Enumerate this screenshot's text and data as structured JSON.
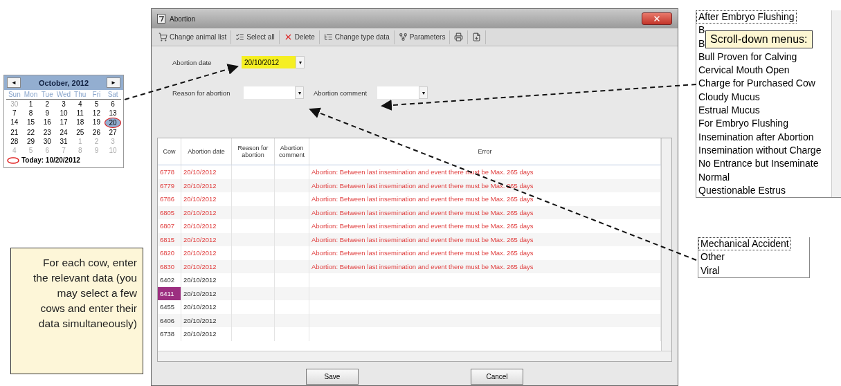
{
  "calendar": {
    "prev": "◄",
    "next": "►",
    "month": "October, 2012",
    "weekdays": [
      "Sun",
      "Mon",
      "Tue",
      "Wed",
      "Thu",
      "Fri",
      "Sat"
    ],
    "weeks": [
      [
        {
          "d": "30",
          "muted": true,
          "selected": false
        },
        {
          "d": "1",
          "muted": false,
          "selected": false
        },
        {
          "d": "2",
          "muted": false,
          "selected": false
        },
        {
          "d": "3",
          "muted": false,
          "selected": false
        },
        {
          "d": "4",
          "muted": false,
          "selected": false
        },
        {
          "d": "5",
          "muted": false,
          "selected": false
        },
        {
          "d": "6",
          "muted": false,
          "selected": false
        }
      ],
      [
        {
          "d": "7",
          "muted": false,
          "selected": false
        },
        {
          "d": "8",
          "muted": false,
          "selected": false
        },
        {
          "d": "9",
          "muted": false,
          "selected": false
        },
        {
          "d": "10",
          "muted": false,
          "selected": false
        },
        {
          "d": "11",
          "muted": false,
          "selected": false
        },
        {
          "d": "12",
          "muted": false,
          "selected": false
        },
        {
          "d": "13",
          "muted": false,
          "selected": false
        }
      ],
      [
        {
          "d": "14",
          "muted": false,
          "selected": false
        },
        {
          "d": "15",
          "muted": false,
          "selected": false
        },
        {
          "d": "16",
          "muted": false,
          "selected": false
        },
        {
          "d": "17",
          "muted": false,
          "selected": false
        },
        {
          "d": "18",
          "muted": false,
          "selected": false
        },
        {
          "d": "19",
          "muted": false,
          "selected": false
        },
        {
          "d": "20",
          "muted": false,
          "selected": true
        }
      ],
      [
        {
          "d": "21",
          "muted": false,
          "selected": false
        },
        {
          "d": "22",
          "muted": false,
          "selected": false
        },
        {
          "d": "23",
          "muted": false,
          "selected": false
        },
        {
          "d": "24",
          "muted": false,
          "selected": false
        },
        {
          "d": "25",
          "muted": false,
          "selected": false
        },
        {
          "d": "26",
          "muted": false,
          "selected": false
        },
        {
          "d": "27",
          "muted": false,
          "selected": false
        }
      ],
      [
        {
          "d": "28",
          "muted": false,
          "selected": false
        },
        {
          "d": "29",
          "muted": false,
          "selected": false
        },
        {
          "d": "30",
          "muted": false,
          "selected": false
        },
        {
          "d": "31",
          "muted": false,
          "selected": false
        },
        {
          "d": "1",
          "muted": true,
          "selected": false
        },
        {
          "d": "2",
          "muted": true,
          "selected": false
        },
        {
          "d": "3",
          "muted": true,
          "selected": false
        }
      ],
      [
        {
          "d": "4",
          "muted": true,
          "selected": false
        },
        {
          "d": "5",
          "muted": true,
          "selected": false
        },
        {
          "d": "6",
          "muted": true,
          "selected": false
        },
        {
          "d": "7",
          "muted": true,
          "selected": false
        },
        {
          "d": "8",
          "muted": true,
          "selected": false
        },
        {
          "d": "9",
          "muted": true,
          "selected": false
        },
        {
          "d": "10",
          "muted": true,
          "selected": false
        }
      ]
    ],
    "today": "Today: 10/20/2012"
  },
  "window": {
    "title": "Abortion"
  },
  "toolbar": [
    {
      "kind": "cart",
      "label": "Change animal list"
    },
    {
      "kind": "select",
      "label": "Select all"
    },
    {
      "kind": "delete",
      "label": "Delete"
    },
    {
      "kind": "type",
      "label": "Change type data"
    },
    {
      "kind": "params",
      "label": "Parameters"
    },
    {
      "kind": "print"
    },
    {
      "kind": "export"
    }
  ],
  "form": {
    "date_label": "Abortion date",
    "date_value": "20/10/2012",
    "reason_label": "Reason for abortion",
    "comment_label": "Abortion comment",
    "date_button": "▾",
    "reason_button": "▾",
    "comment_button": "▾"
  },
  "table": {
    "columns": [
      "Cow",
      "Abortion date",
      "Reason for abortion",
      "Abortion comment",
      "Error"
    ],
    "rows": [
      {
        "cow": "6778",
        "date": "20/10/2012",
        "error": "Abortion: Between last insemination and event there must be Max. 265 days",
        "selected": false
      },
      {
        "cow": "6779",
        "date": "20/10/2012",
        "error": "Abortion: Between last insemination and event there must be Max. 265 days",
        "selected": false
      },
      {
        "cow": "6786",
        "date": "20/10/2012",
        "error": "Abortion: Between last insemination and event there must be Max. 265 days",
        "selected": false
      },
      {
        "cow": "6805",
        "date": "20/10/2012",
        "error": "Abortion: Between last insemination and event there must be Max. 265 days",
        "selected": false
      },
      {
        "cow": "6807",
        "date": "20/10/2012",
        "error": "Abortion: Between last insemination and event there must be Max. 265 days",
        "selected": false
      },
      {
        "cow": "6815",
        "date": "20/10/2012",
        "error": "Abortion: Between last insemination and event there must be Max. 265 days",
        "selected": false
      },
      {
        "cow": "6820",
        "date": "20/10/2012",
        "error": "Abortion: Between last insemination and event there must be Max. 265 days",
        "selected": false
      },
      {
        "cow": "6830",
        "date": "20/10/2012",
        "error": "Abortion: Between last insemination and event there must be Max. 265 days",
        "selected": false
      },
      {
        "cow": "6402",
        "date": "20/10/2012",
        "selected": false
      },
      {
        "cow": "6411",
        "date": "20/10/2012",
        "selected": true
      },
      {
        "cow": "6455",
        "date": "20/10/2012",
        "selected": false
      },
      {
        "cow": "6406",
        "date": "20/10/2012",
        "selected": false
      },
      {
        "cow": "6738",
        "date": "20/10/2012",
        "selected": false
      }
    ]
  },
  "buttons": [
    "Save",
    "Cancel"
  ],
  "comment_list": {
    "items": [
      "After Embryo Flushing",
      "B",
      "B",
      "Bull Proven for Calving",
      "Cervical Mouth Open",
      "Charge for Purchased Cow",
      "Cloudy Mucus",
      "Estrual Mucus",
      "For Embryo Flushing",
      "Insemination after Abortion",
      "Insemination without Charge",
      "No Entrance but Inseminate",
      "Normal",
      "Questionable Estrus"
    ]
  },
  "tooltip": "Scroll-down menus:",
  "reason_list": {
    "items": [
      "Mechanical Accident",
      "Other",
      "Viral"
    ]
  },
  "callout": "For each cow, enter the relevant data (you may select a few cows and enter their data simultaneously)"
}
